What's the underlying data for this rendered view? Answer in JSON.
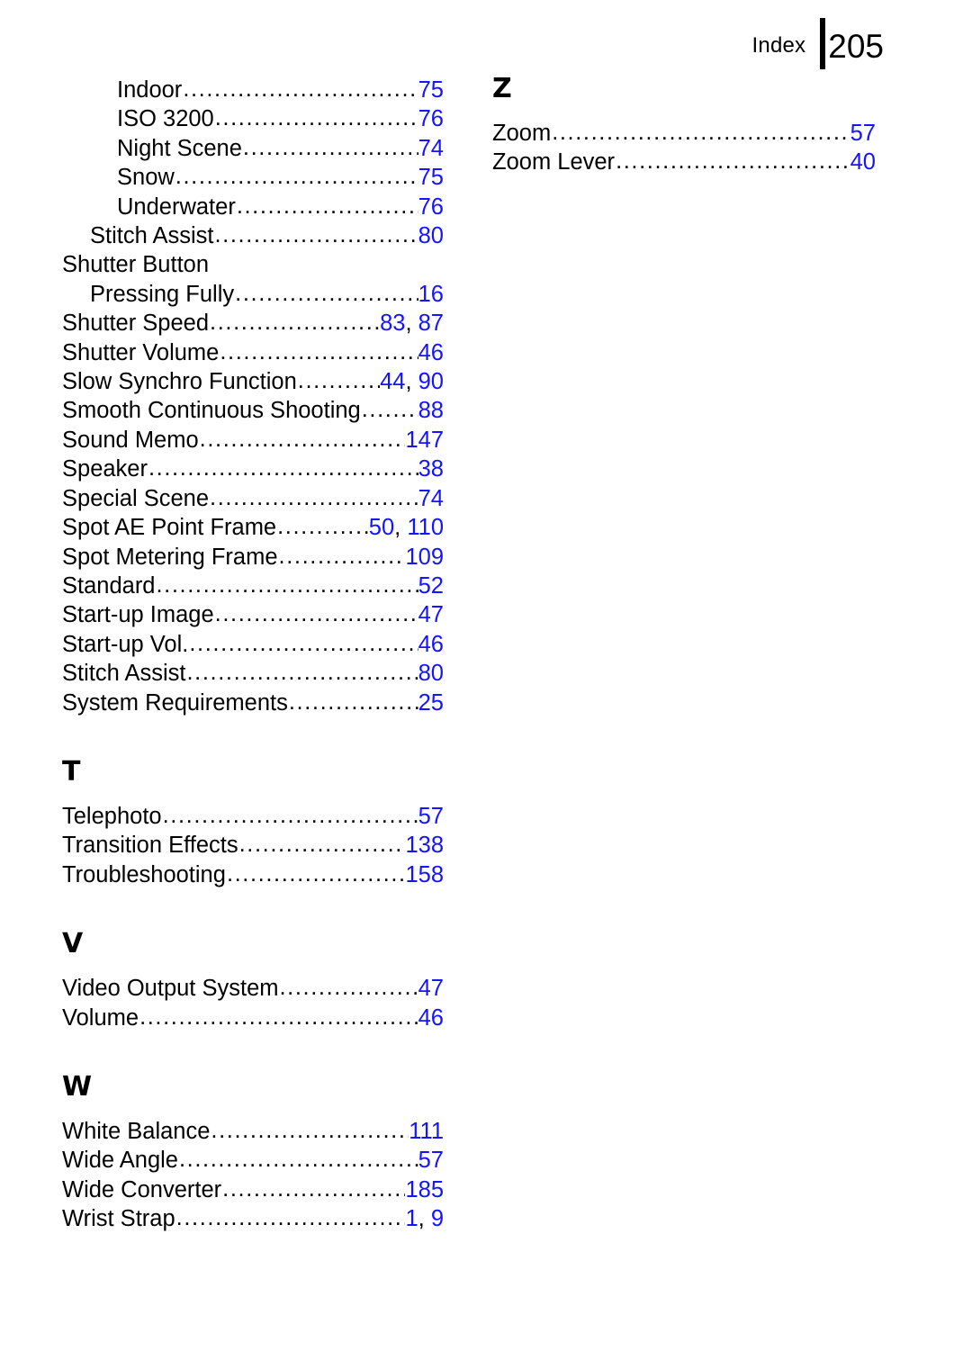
{
  "header": {
    "label": "Index",
    "page_number": "205"
  },
  "colors": {
    "page_number_blue": "#1414ff",
    "text_black": "#000000",
    "background": "#ffffff"
  },
  "columns": [
    {
      "name": "left-column",
      "blocks": [
        {
          "type": "entries",
          "entries": [
            {
              "title": "Indoor",
              "indent": 2,
              "pages": [
                "75"
              ]
            },
            {
              "title": "ISO 3200",
              "indent": 2,
              "pages": [
                "76"
              ]
            },
            {
              "title": "Night Scene",
              "indent": 2,
              "pages": [
                "74"
              ]
            },
            {
              "title": "Snow",
              "indent": 2,
              "pages": [
                "75"
              ]
            },
            {
              "title": "Underwater",
              "indent": 2,
              "pages": [
                "76"
              ]
            },
            {
              "title": "Stitch Assist",
              "indent": 1,
              "pages": [
                "80"
              ]
            },
            {
              "title": "Shutter Button",
              "indent": 0,
              "pages": []
            },
            {
              "title": "Pressing Fully",
              "indent": 1,
              "pages": [
                "16"
              ]
            },
            {
              "title": "Shutter Speed",
              "indent": 0,
              "pages": [
                "83",
                "87"
              ]
            },
            {
              "title": "Shutter Volume",
              "indent": 0,
              "pages": [
                "46"
              ]
            },
            {
              "title": "Slow Synchro Function",
              "indent": 0,
              "pages": [
                "44",
                "90"
              ]
            },
            {
              "title": "Smooth Continuous Shooting",
              "indent": 0,
              "pages": [
                "88"
              ]
            },
            {
              "title": "Sound Memo",
              "indent": 0,
              "pages": [
                "147"
              ]
            },
            {
              "title": "Speaker",
              "indent": 0,
              "pages": [
                "38"
              ]
            },
            {
              "title": "Special Scene",
              "indent": 0,
              "pages": [
                "74"
              ]
            },
            {
              "title": "Spot AE Point Frame",
              "indent": 0,
              "pages": [
                "50",
                "110"
              ]
            },
            {
              "title": "Spot Metering Frame",
              "indent": 0,
              "pages": [
                "109"
              ]
            },
            {
              "title": "Standard",
              "indent": 0,
              "pages": [
                "52"
              ]
            },
            {
              "title": "Start-up Image",
              "indent": 0,
              "pages": [
                "47"
              ]
            },
            {
              "title": "Start-up Vol.",
              "indent": 0,
              "pages": [
                "46"
              ]
            },
            {
              "title": "Stitch Assist",
              "indent": 0,
              "pages": [
                "80"
              ]
            },
            {
              "title": "System Requirements",
              "indent": 0,
              "pages": [
                "25"
              ]
            }
          ]
        },
        {
          "type": "section",
          "letter": "T",
          "entries": [
            {
              "title": "Telephoto",
              "indent": 0,
              "pages": [
                "57"
              ]
            },
            {
              "title": "Transition Effects",
              "indent": 0,
              "pages": [
                "138"
              ]
            },
            {
              "title": "Troubleshooting",
              "indent": 0,
              "pages": [
                "158"
              ]
            }
          ]
        },
        {
          "type": "section",
          "letter": "V",
          "entries": [
            {
              "title": "Video Output System",
              "indent": 0,
              "pages": [
                "47"
              ]
            },
            {
              "title": "Volume",
              "indent": 0,
              "pages": [
                "46"
              ]
            }
          ]
        },
        {
          "type": "section",
          "letter": "W",
          "entries": [
            {
              "title": "White Balance",
              "indent": 0,
              "pages": [
                "111"
              ]
            },
            {
              "title": "Wide Angle",
              "indent": 0,
              "pages": [
                "57"
              ]
            },
            {
              "title": "Wide Converter",
              "indent": 0,
              "pages": [
                "185"
              ]
            },
            {
              "title": "Wrist Strap",
              "indent": 0,
              "pages": [
                "1",
                "9"
              ]
            }
          ]
        }
      ]
    },
    {
      "name": "right-column",
      "blocks": [
        {
          "type": "section",
          "letter": "Z",
          "first": true,
          "entries": [
            {
              "title": "Zoom",
              "indent": 0,
              "pages": [
                "57"
              ]
            },
            {
              "title": "Zoom Lever",
              "indent": 0,
              "pages": [
                "40"
              ]
            }
          ]
        }
      ]
    }
  ]
}
